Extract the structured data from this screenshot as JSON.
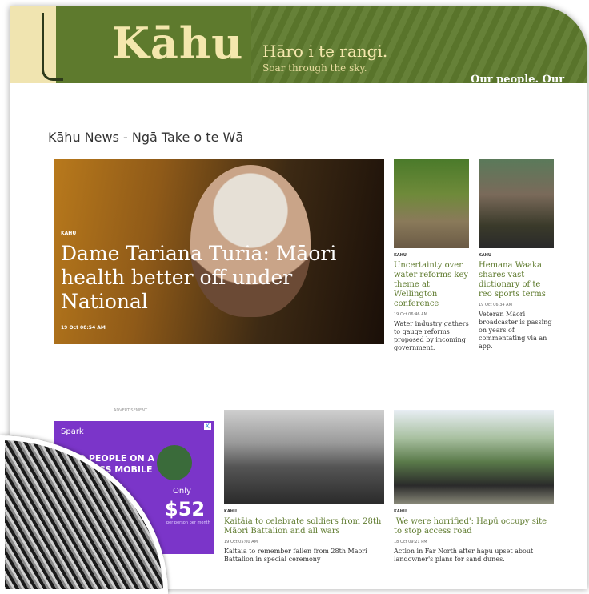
{
  "header": {
    "brand": "Kāhu",
    "tagline_maori": "Hāro i te rangi.",
    "tagline_english": "Soar through the sky.",
    "slogan": "Our people. Our stories.",
    "colors": {
      "bar": "#5e7a2d",
      "brand_text": "#f4e7ad",
      "left_strip": "#f0e4b0"
    }
  },
  "section": {
    "title": "Kāhu News - Ngā Take o te Wā"
  },
  "hero": {
    "kicker": "KAHU",
    "headline": "Dame Tariana Turia: Māori health better off under National",
    "time": "19 Oct 08:54 AM"
  },
  "side_stories": [
    {
      "kicker": "KAHU",
      "title": "Uncertainty over water reforms key theme at Wellington conference",
      "time": "19 Oct 06:46 AM",
      "desc": "Water industry gathers to gauge reforms proposed by incoming government."
    },
    {
      "kicker": "KAHU",
      "title": "Hemana Waaka shares vast dictionary of te reo sports terms",
      "time": "19 Oct 06:34 AM",
      "desc": "Veteran Māori broadcaster is passing on years of commentating via an app."
    }
  ],
  "ad": {
    "label": "ADVERTISEMENT",
    "brand": "Spark",
    "copy": "TWO PEOPLE ON A BUSINESS MOBILE PLAN",
    "only": "Only",
    "price": "$52",
    "fine": "per person per month",
    "close": "X"
  },
  "bottom_stories": [
    {
      "kicker": "KAHU",
      "title": "Kaitāia to celebrate soldiers from 28th Māori Battalion and all wars",
      "time": "19 Oct 05:00 AM",
      "desc": "Kaitaia to remember fallen from 28th Maori Battalion in special ceremony"
    },
    {
      "kicker": "KAHU",
      "title": "'We were horrified': Hapū occupy site to stop access road",
      "time": "18 Oct 09:21 PM",
      "desc": "Action in Far North after hapu upset about landowner's plans for sand dunes."
    }
  ]
}
